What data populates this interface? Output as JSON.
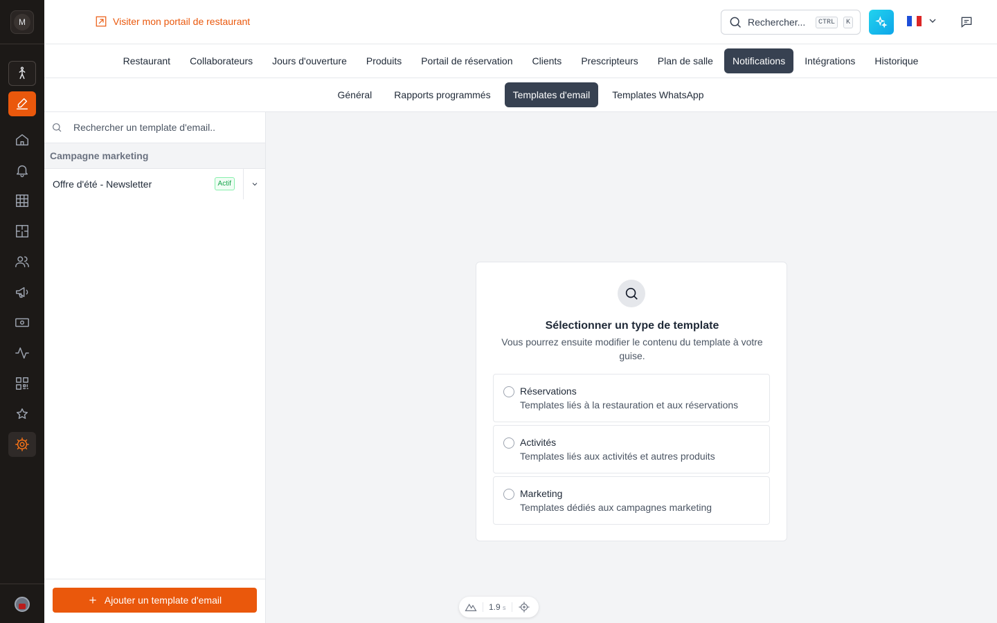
{
  "rail": {
    "workspace_initial": "M",
    "items": [
      {
        "icon": "walking-person-icon",
        "style": "boxed"
      },
      {
        "icon": "edit-pen-icon",
        "style": "orange"
      },
      {
        "icon": "home-icon",
        "style": "plain"
      },
      {
        "icon": "bell-icon",
        "style": "plain"
      },
      {
        "icon": "grid-icon",
        "style": "plain"
      },
      {
        "icon": "floor-plan-icon",
        "style": "plain"
      },
      {
        "icon": "users-icon",
        "style": "plain"
      },
      {
        "icon": "megaphone-icon",
        "style": "plain"
      },
      {
        "icon": "cash-icon",
        "style": "plain"
      },
      {
        "icon": "activity-icon",
        "style": "plain"
      },
      {
        "icon": "qr-code-icon",
        "style": "plain"
      },
      {
        "icon": "sparkle-star-icon",
        "style": "plain"
      },
      {
        "icon": "gear-icon",
        "style": "active"
      }
    ]
  },
  "header": {
    "portal_link": "Visiter mon portail de restaurant",
    "search_label": "Rechercher...",
    "kbd_ctrl": "CTRL",
    "kbd_k": "K",
    "accent_color": "#ea580c"
  },
  "main_tabs": [
    {
      "label": "Restaurant",
      "active": false
    },
    {
      "label": "Collaborateurs",
      "active": false
    },
    {
      "label": "Jours d'ouverture",
      "active": false
    },
    {
      "label": "Produits",
      "active": false
    },
    {
      "label": "Portail de réservation",
      "active": false
    },
    {
      "label": "Clients",
      "active": false
    },
    {
      "label": "Prescripteurs",
      "active": false
    },
    {
      "label": "Plan de salle",
      "active": false
    },
    {
      "label": "Notifications",
      "active": true
    },
    {
      "label": "Intégrations",
      "active": false
    },
    {
      "label": "Historique",
      "active": false
    }
  ],
  "sub_tabs": [
    {
      "label": "Général",
      "active": false
    },
    {
      "label": "Rapports programmés",
      "active": false
    },
    {
      "label": "Templates d'email",
      "active": true
    },
    {
      "label": "Templates WhatsApp",
      "active": false
    }
  ],
  "left_panel": {
    "search_placeholder": "Rechercher un template d'email..",
    "group_title": "Campagne marketing",
    "templates": [
      {
        "name": "Offre d'été - Newsletter",
        "status": "Actif"
      }
    ],
    "add_button": "Ajouter un template d'email"
  },
  "card": {
    "title": "Sélectionner un type de template",
    "description": "Vous pourrez ensuite modifier le contenu du template à votre guise.",
    "options": [
      {
        "title": "Réservations",
        "subtitle": "Templates liés à la restauration et aux réservations"
      },
      {
        "title": "Activités",
        "subtitle": "Templates liés aux activités et autres produits"
      },
      {
        "title": "Marketing",
        "subtitle": "Templates dédiés aux campagnes marketing"
      }
    ]
  },
  "dev_pill": {
    "time": "1.9",
    "unit": "s"
  }
}
